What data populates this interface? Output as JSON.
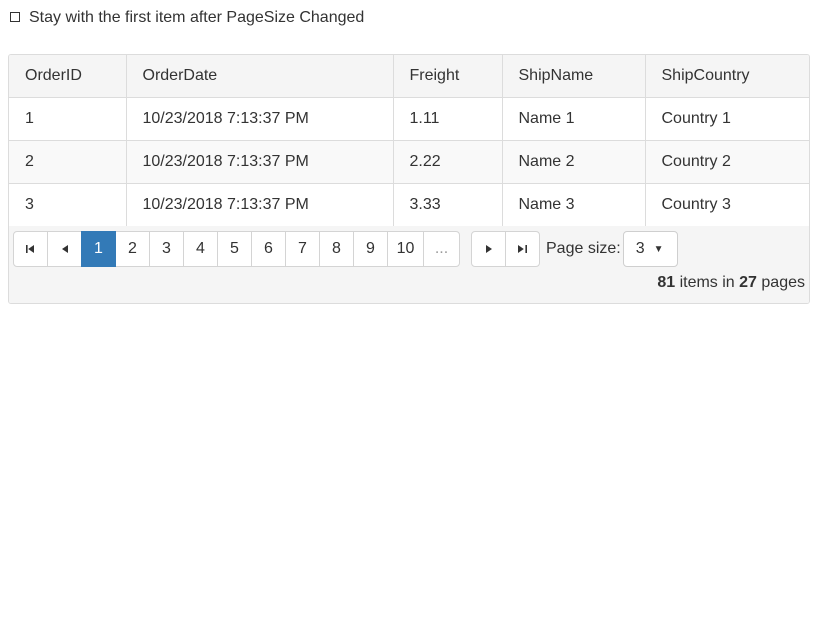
{
  "option": {
    "label": "Stay with the first item after PageSize Changed",
    "checked": false
  },
  "table": {
    "columns": [
      "OrderID",
      "OrderDate",
      "Freight",
      "ShipName",
      "ShipCountry"
    ],
    "rows": [
      [
        "1",
        "10/23/2018 7:13:37 PM",
        "1.11",
        "Name 1",
        "Country 1"
      ],
      [
        "2",
        "10/23/2018 7:13:37 PM",
        "2.22",
        "Name 2",
        "Country 2"
      ],
      [
        "3",
        "10/23/2018 7:13:37 PM",
        "3.33",
        "Name 3",
        "Country 3"
      ]
    ]
  },
  "pager": {
    "first_icon": "first-page-icon",
    "prev_icon": "prev-page-icon",
    "next_icon": "next-page-icon",
    "last_icon": "last-page-icon",
    "pages": [
      "1",
      "2",
      "3",
      "4",
      "5",
      "6",
      "7",
      "8",
      "9",
      "10"
    ],
    "active_page": "1",
    "ellipsis": "...",
    "page_size_label": "Page size:",
    "page_size_value": "3",
    "dropdown_icon": "caret-down-icon",
    "total_items": "81",
    "items_in_text": "items in",
    "total_pages": "27",
    "pages_text": "pages",
    "accent_color": "#337ab7"
  }
}
